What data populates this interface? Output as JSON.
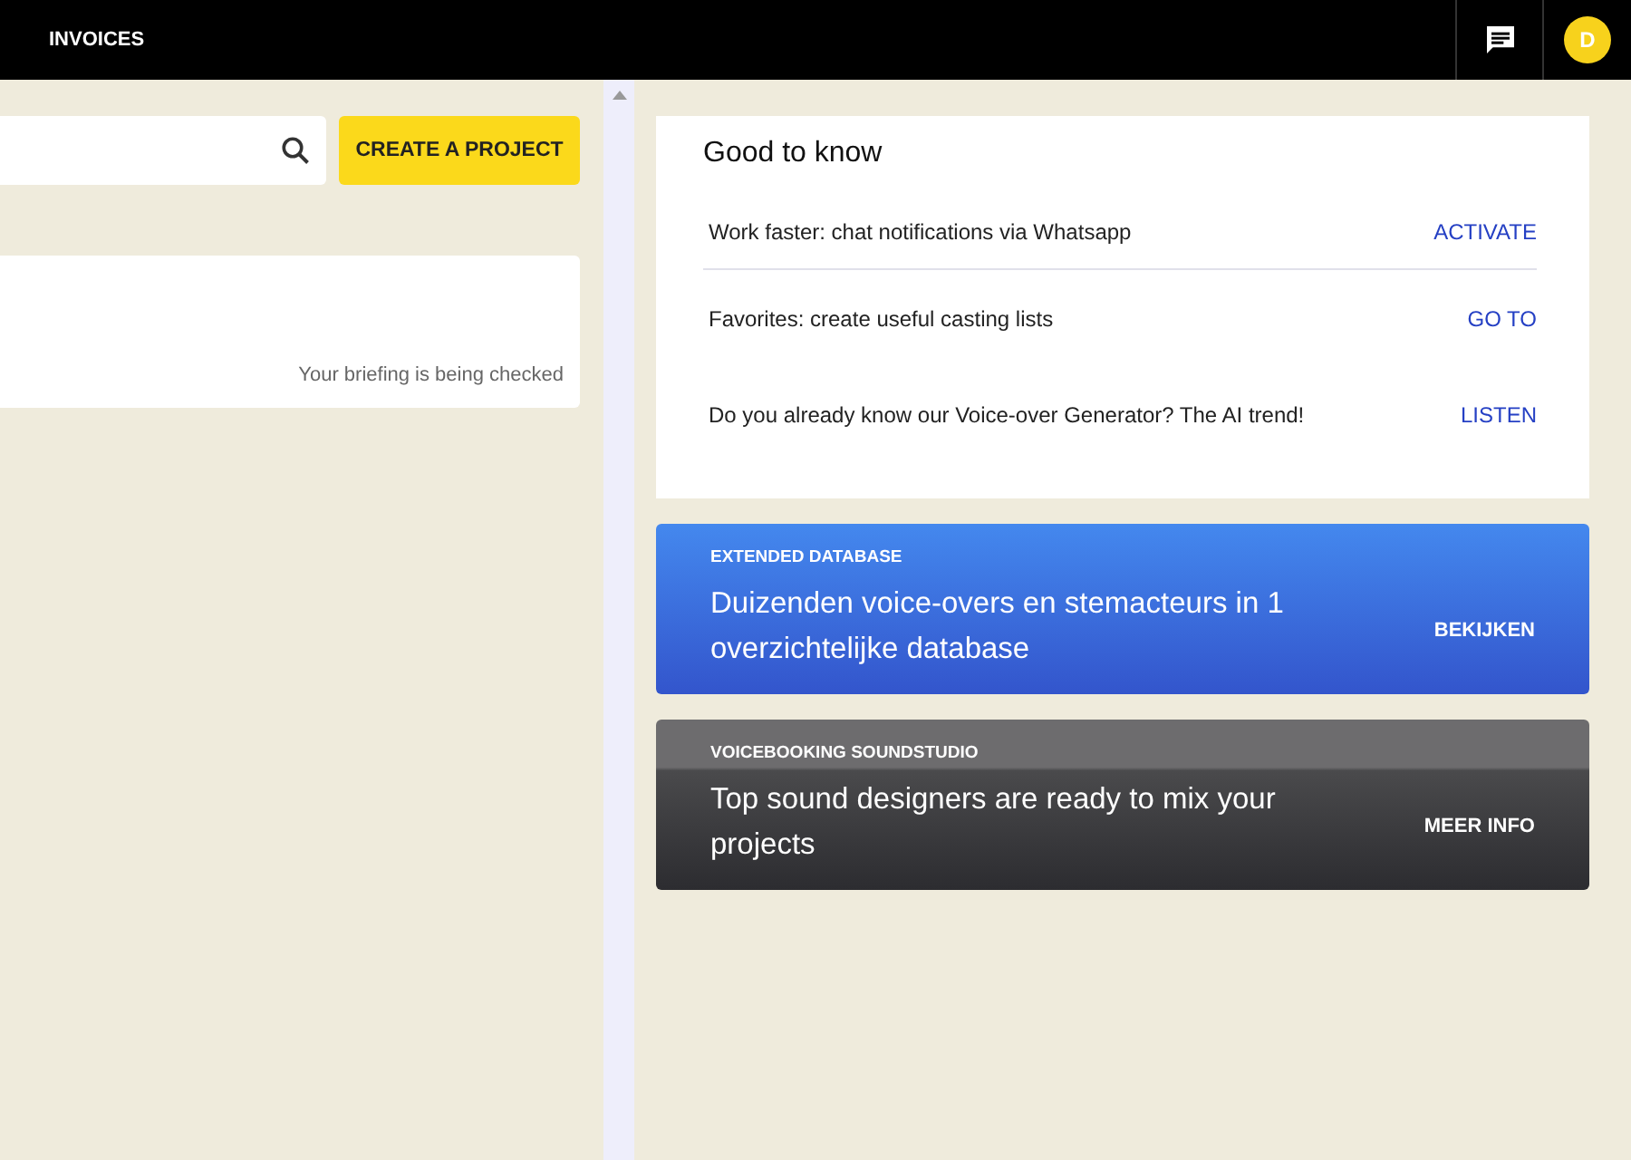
{
  "topbar": {
    "nav_label": "INVOICES",
    "avatar_initial": "D"
  },
  "left": {
    "create_button": "CREATE A PROJECT",
    "project_card": {
      "status": "Your briefing is being checked"
    }
  },
  "good_to_know": {
    "title": "Good to know",
    "items": [
      {
        "text": "Work faster: chat notifications via Whatsapp",
        "action": "ACTIVATE"
      },
      {
        "text": "Favorites: create useful casting lists",
        "action": "GO TO"
      },
      {
        "text": "Do you already know our Voice-over Generator? The AI trend!",
        "action": "LISTEN"
      }
    ]
  },
  "banners": [
    {
      "kind": "blue",
      "label": "EXTENDED DATABASE",
      "headline": "Duizenden voice-overs en stemacteurs in 1 overzichtelijke database",
      "action": "BEKIJKEN"
    },
    {
      "kind": "dark",
      "label": "VOICEBOOKING SOUNDSTUDIO",
      "headline": "Top sound designers are ready to mix your projects",
      "action": "MEER INFO"
    }
  ]
}
